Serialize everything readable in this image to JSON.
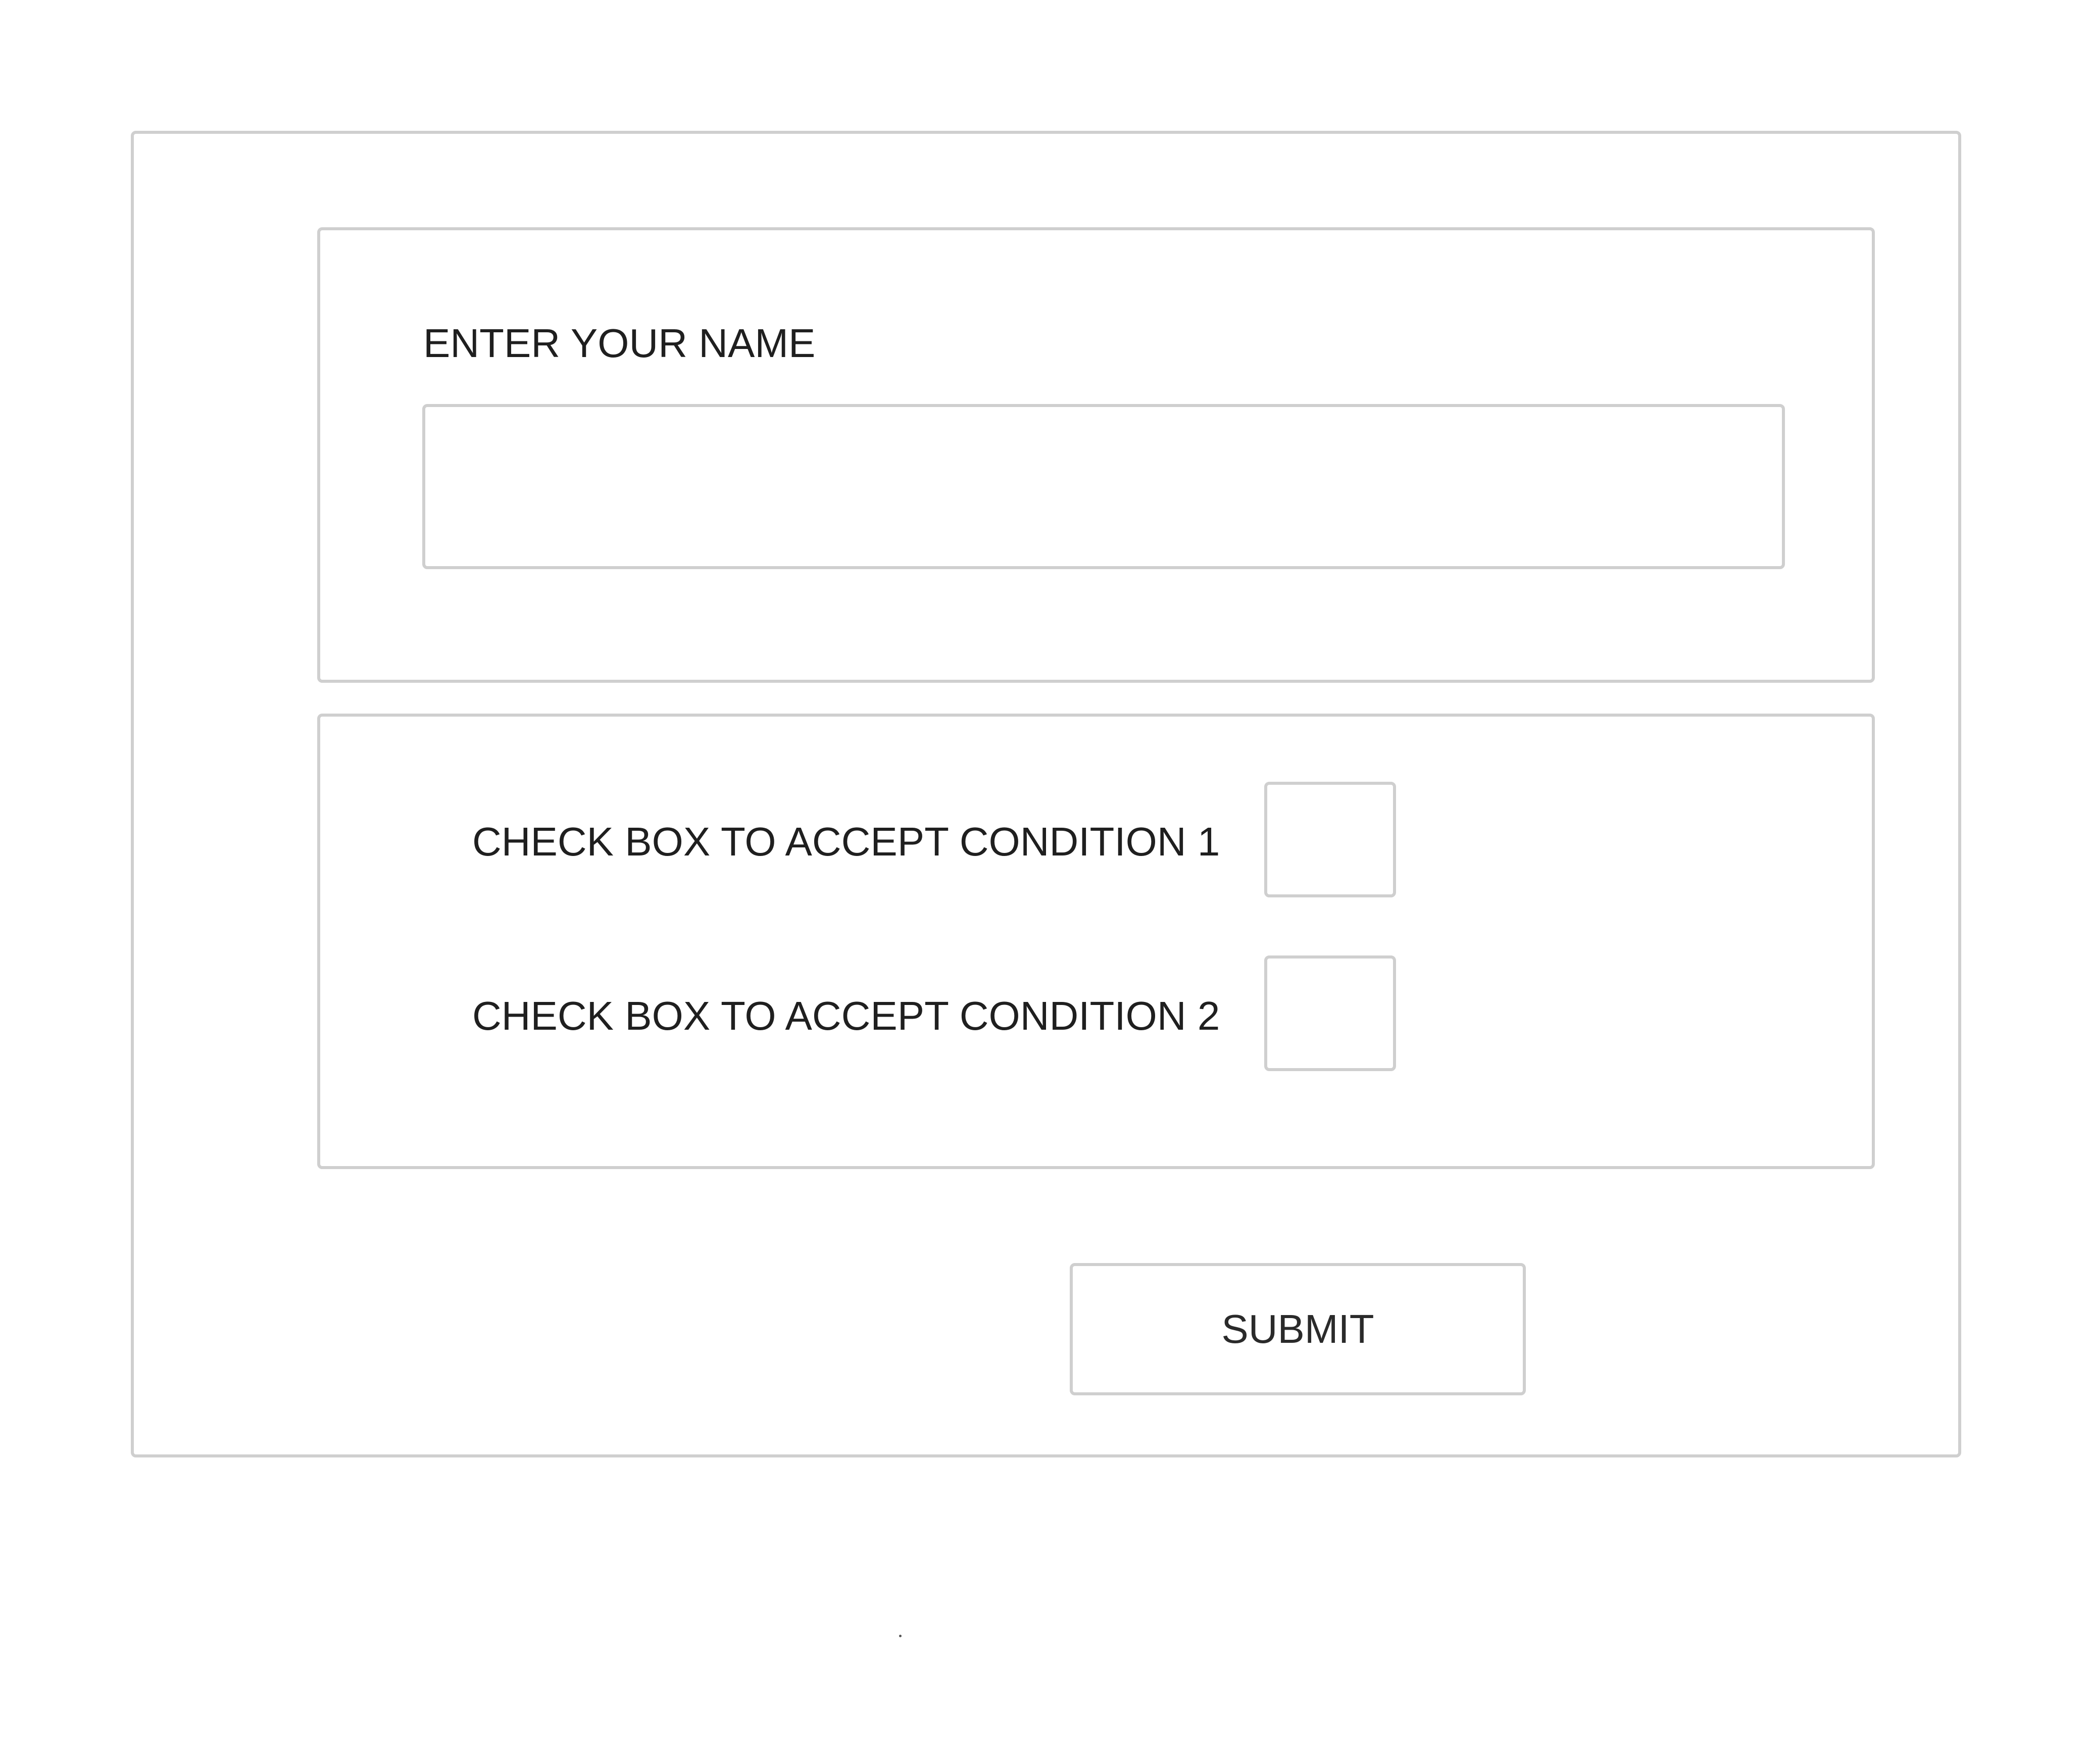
{
  "form": {
    "name_section": {
      "label": "ENTER YOUR NAME",
      "input_value": "",
      "input_placeholder": ""
    },
    "conditions_section": {
      "conditions": [
        {
          "label": "CHECK BOX TO ACCEPT CONDITION 1",
          "checked": false
        },
        {
          "label": "CHECK BOX TO ACCEPT CONDITION 2",
          "checked": false
        }
      ]
    },
    "submit_label": "SUBMIT"
  },
  "colors": {
    "border": "#cfcfcf",
    "text": "#1f1f1f",
    "background": "#ffffff"
  }
}
